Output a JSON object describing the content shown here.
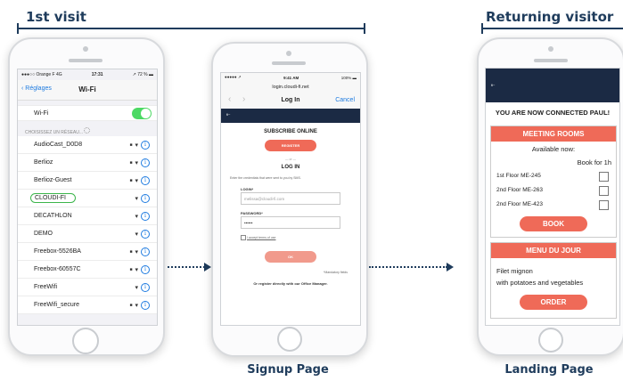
{
  "headers": {
    "first_visit": "1st visit",
    "returning": "Returning visitor"
  },
  "captions": {
    "signup": "Signup Page",
    "landing": "Landing Page"
  },
  "wifi": {
    "status_carrier": "●●●○○ Orange F 4G",
    "status_time": "17:31",
    "status_battery": "↗ 72 % ▬",
    "back_label": "Réglages",
    "title": "Wi-Fi",
    "wifi_label": "Wi-Fi",
    "section_label": "CHOISISSEZ UN RÉSEAU...",
    "networks": [
      {
        "name": "AudioCast_D0D8",
        "locked": true
      },
      {
        "name": "Berlioz",
        "locked": true
      },
      {
        "name": "Berlioz-Guest",
        "locked": true
      },
      {
        "name": "CLOUDI-FI",
        "locked": false
      },
      {
        "name": "DECATHLON",
        "locked": false
      },
      {
        "name": "DEMO",
        "locked": false
      },
      {
        "name": "Freebox-5526BA",
        "locked": true
      },
      {
        "name": "Freebox-60557C",
        "locked": true
      },
      {
        "name": "FreeWifi",
        "locked": false
      },
      {
        "name": "FreeWifi_secure",
        "locked": true
      }
    ]
  },
  "signup": {
    "status_carrier": "●●●●● ↗",
    "status_time": "9:41 AM",
    "status_battery": "100% ▬",
    "url": "login.cloudi-fi.net",
    "title": "Log In",
    "cancel": "Cancel",
    "banner_logo": "fi~",
    "subscribe_heading": "SUBSCRIBE ONLINE",
    "register_button": "REGISTER",
    "or": "— or —",
    "login_heading": "LOG IN",
    "instructions": "Enter the credentials that were sent to you by SMS.",
    "login_label": "LOGIN*",
    "login_value": "melissa@cloudi-fi.com",
    "password_label": "PASSWORD*",
    "password_value": "••••••",
    "terms": "I accept terms of use",
    "ok_button": "OK",
    "mandatory": "*Mandatory fields",
    "footer": "Or register directly with our Office Manager."
  },
  "landing": {
    "banner_logo": "fi~",
    "welcome": "YOU ARE NOW CONNECTED PAUL!",
    "meeting": {
      "title": "MEETING ROOMS",
      "available": "Available now:",
      "book_for": "Book for 1h",
      "rooms": [
        "1st Floor ME-245",
        "2nd Floor ME-263",
        "2nd Floor ME-423"
      ],
      "button": "BOOK"
    },
    "menu": {
      "title": "MENU DU JOUR",
      "line1": "Filet mignon",
      "line2": "with potatoes and vegetables",
      "button": "ORDER"
    }
  },
  "colors": {
    "accent": "#ef6a58",
    "navy": "#1f3c5c",
    "ios_blue": "#1e7be0",
    "toggle_green": "#4cd964",
    "banner": "#1b2a44"
  }
}
